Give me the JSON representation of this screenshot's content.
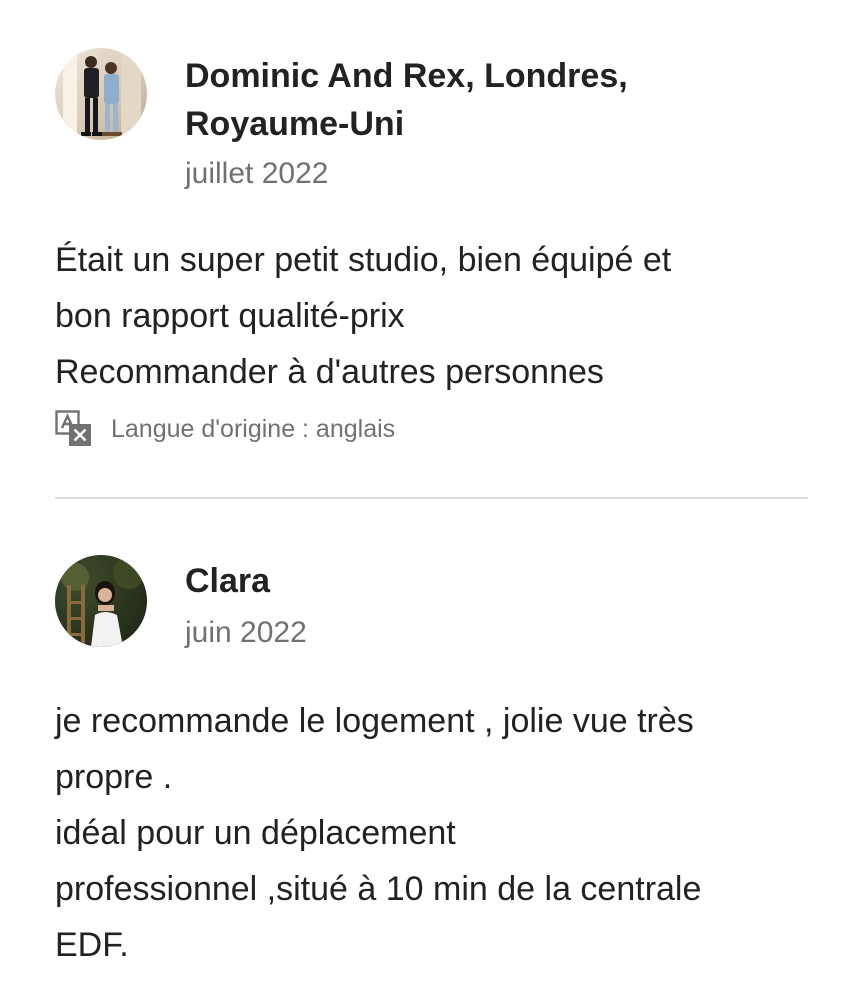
{
  "reviews": [
    {
      "author": "Dominic And Rex, Londres, Royaume-Uni",
      "date": "juillet 2022",
      "text": "Était un super petit studio, bien équipé et\nbon rapport qualité-prix\nRecommander à d'autres personnes",
      "translation_note": "Langue d'origine : anglais",
      "avatar_icon": "user-photo-couple"
    },
    {
      "author": "Clara",
      "date": "juin 2022",
      "text": "je recommande le logement , jolie vue très\npropre .\nidéal pour un déplacement\nprofessionnel ,situé à 10 min de la centrale\nEDF.",
      "avatar_icon": "user-photo-woman"
    }
  ],
  "icons": {
    "translate": "translate-icon"
  },
  "colors": {
    "text_primary": "#222222",
    "text_secondary": "#717171",
    "divider": "#dddddd"
  }
}
